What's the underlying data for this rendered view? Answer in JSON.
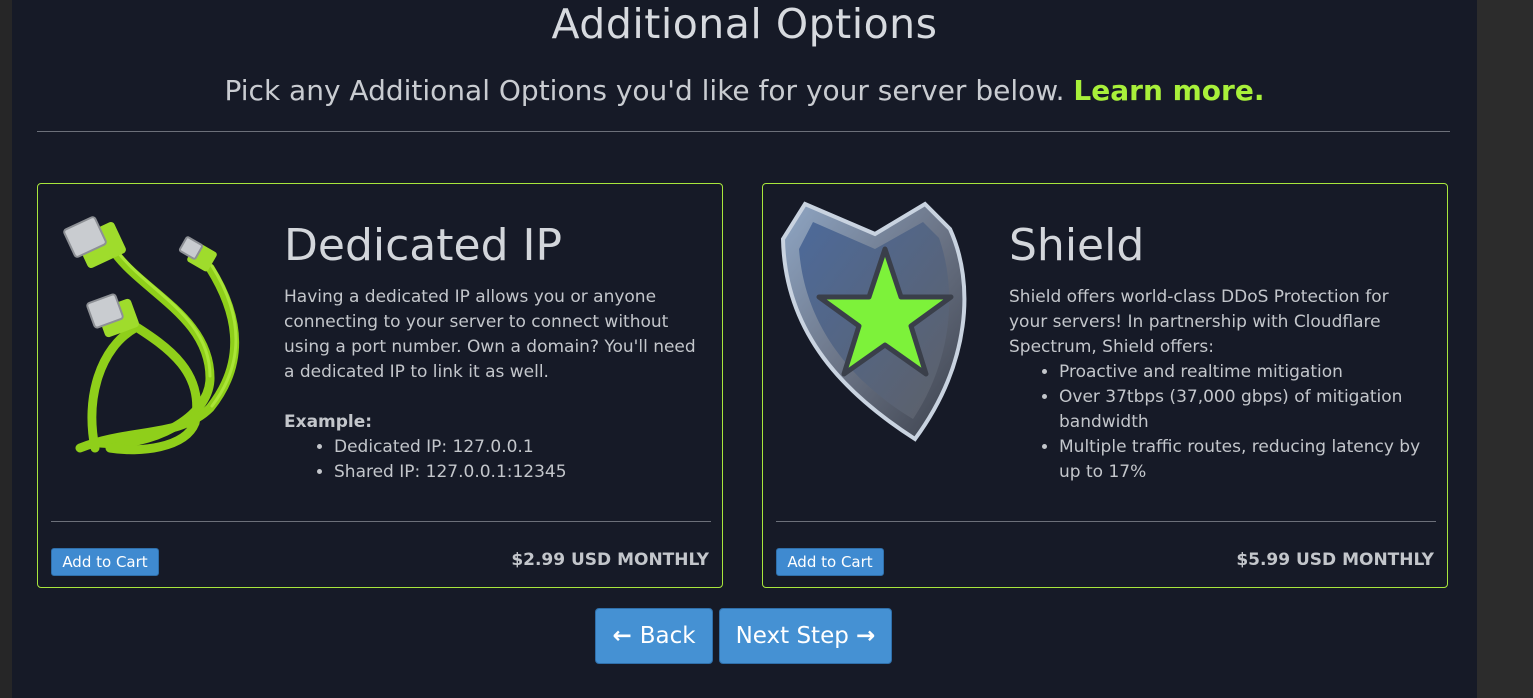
{
  "header": {
    "title": "Additional Options",
    "subtitle": "Pick any Additional Options you'd like for your server below.",
    "learn_more": "Learn more."
  },
  "options": [
    {
      "title": "Dedicated IP",
      "description": "Having a dedicated IP allows you or anyone connecting to your server to connect without using a port number. Own a domain? You'll need a dedicated IP to link it as well.",
      "example_label": "Example:",
      "bullets": [
        "Dedicated IP: 127.0.0.1",
        "Shared IP: 127.0.0.1:12345"
      ],
      "add_label": "Add to Cart",
      "price": "$2.99 USD MONTHLY",
      "image_icon": "ethernet-cable-icon"
    },
    {
      "title": "Shield",
      "description": "Shield offers world-class DDoS Protection for your servers! In partnership with Cloudflare Spectrum, Shield offers:",
      "bullets": [
        "Proactive and realtime mitigation",
        "Over 37tbps (37,000 gbps) of mitigation bandwidth",
        "Multiple traffic routes, reducing latency by up to 17%"
      ],
      "add_label": "Add to Cart",
      "price": "$5.99 USD MONTHLY",
      "image_icon": "shield-star-icon"
    }
  ],
  "nav": {
    "back_label": "Back",
    "next_label": "Next Step",
    "back_icon": "arrow-left-icon",
    "next_icon": "arrow-right-icon"
  },
  "colors": {
    "accent": "#a8f03a",
    "button": "#4591d3",
    "panel": "#161a27"
  }
}
